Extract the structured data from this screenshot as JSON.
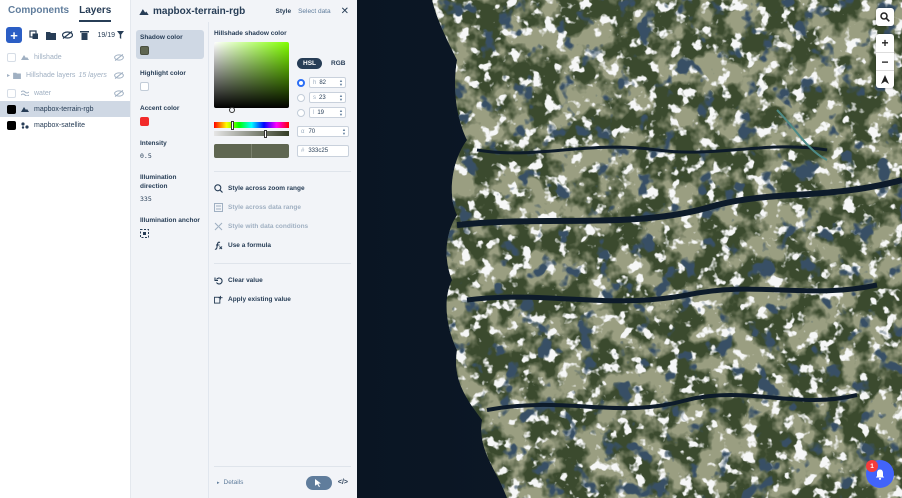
{
  "left_panel": {
    "tabs": [
      "Components",
      "Layers"
    ],
    "active_tab": "Layers",
    "layer_count": "19/19",
    "layers": [
      {
        "label": "hillshade",
        "sublabel": "",
        "state": "hidden"
      },
      {
        "label": "Hillshade layers",
        "sublabel": "15 layers",
        "state": "group"
      },
      {
        "label": "water",
        "sublabel": "",
        "state": "hidden"
      },
      {
        "label": "mapbox-terrain-rgb",
        "sublabel": "",
        "state": "selected"
      },
      {
        "label": "mapbox-satellite",
        "sublabel": "",
        "state": "visible"
      }
    ]
  },
  "editor": {
    "layer_name": "mapbox-terrain-rgb",
    "tabs": [
      "Style",
      "Select data"
    ],
    "active_tab": "Style",
    "properties": [
      {
        "label": "Shadow color",
        "type": "color",
        "value": "#5f6651",
        "selected": true
      },
      {
        "label": "Highlight color",
        "type": "color",
        "value": "#ffffff",
        "selected": false
      },
      {
        "label": "Accent color",
        "type": "color",
        "value": "#f22a2a",
        "selected": false
      },
      {
        "label": "Intensity",
        "type": "number",
        "value": "0.5",
        "selected": false
      },
      {
        "label": "Illumination direction",
        "type": "number",
        "value": "335",
        "selected": false
      },
      {
        "label": "Illumination anchor",
        "type": "icon",
        "value": "viewport-anchor-icon",
        "selected": false
      }
    ],
    "picker": {
      "title": "Hillshade shadow color",
      "modes": [
        "HSL",
        "RGB"
      ],
      "active_mode": "HSL",
      "h_key": "h",
      "h": "82",
      "s_key": "s",
      "s": "23",
      "l_key": "l",
      "l": "19",
      "alpha_key": "α",
      "alpha": "70",
      "hex_key": "#",
      "hex": "333c25"
    },
    "actions": [
      {
        "label": "Style across zoom range",
        "enabled": true,
        "icon": "zoom-range-icon"
      },
      {
        "label": "Style across data range",
        "enabled": false,
        "icon": "data-range-icon"
      },
      {
        "label": "Style with data conditions",
        "enabled": false,
        "icon": "data-conditions-icon"
      },
      {
        "label": "Use a formula",
        "enabled": true,
        "icon": "formula-icon"
      }
    ],
    "value_actions": [
      {
        "label": "Clear value",
        "icon": "undo-icon"
      },
      {
        "label": "Apply existing value",
        "icon": "apply-value-icon"
      }
    ],
    "footer": {
      "details_label": "Details",
      "code_label": "</>"
    }
  },
  "map": {
    "notification_count": "1",
    "colors": {
      "water": "#0b1626",
      "bell": "#4264fb",
      "badge": "#f43c3c"
    }
  }
}
